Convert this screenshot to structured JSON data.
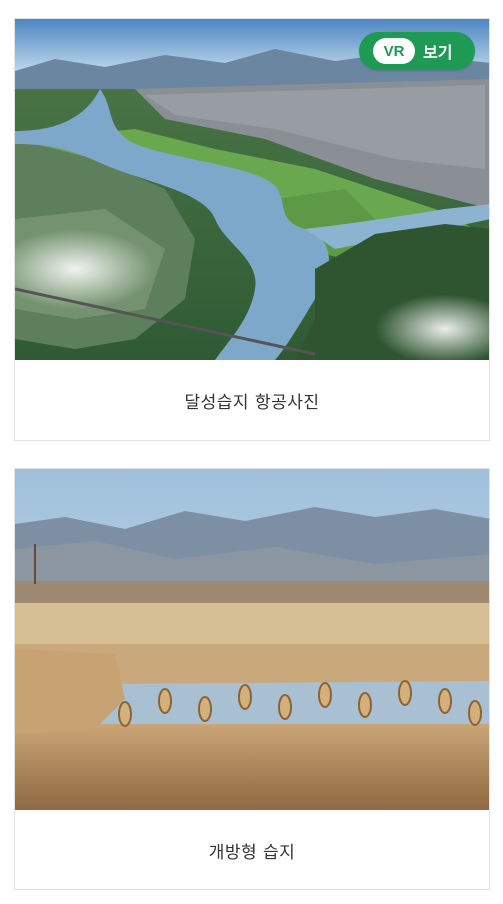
{
  "cards": [
    {
      "caption": "달성습지 항공사진",
      "vr_button": {
        "badge": "VR",
        "label": "보기"
      }
    },
    {
      "caption": "개방형 습지"
    }
  ],
  "colors": {
    "vr_green": "#1f9a54",
    "border": "#e3e3e3",
    "caption_text": "#333333"
  },
  "icons": {
    "vr_badge": "vr-badge-icon"
  }
}
